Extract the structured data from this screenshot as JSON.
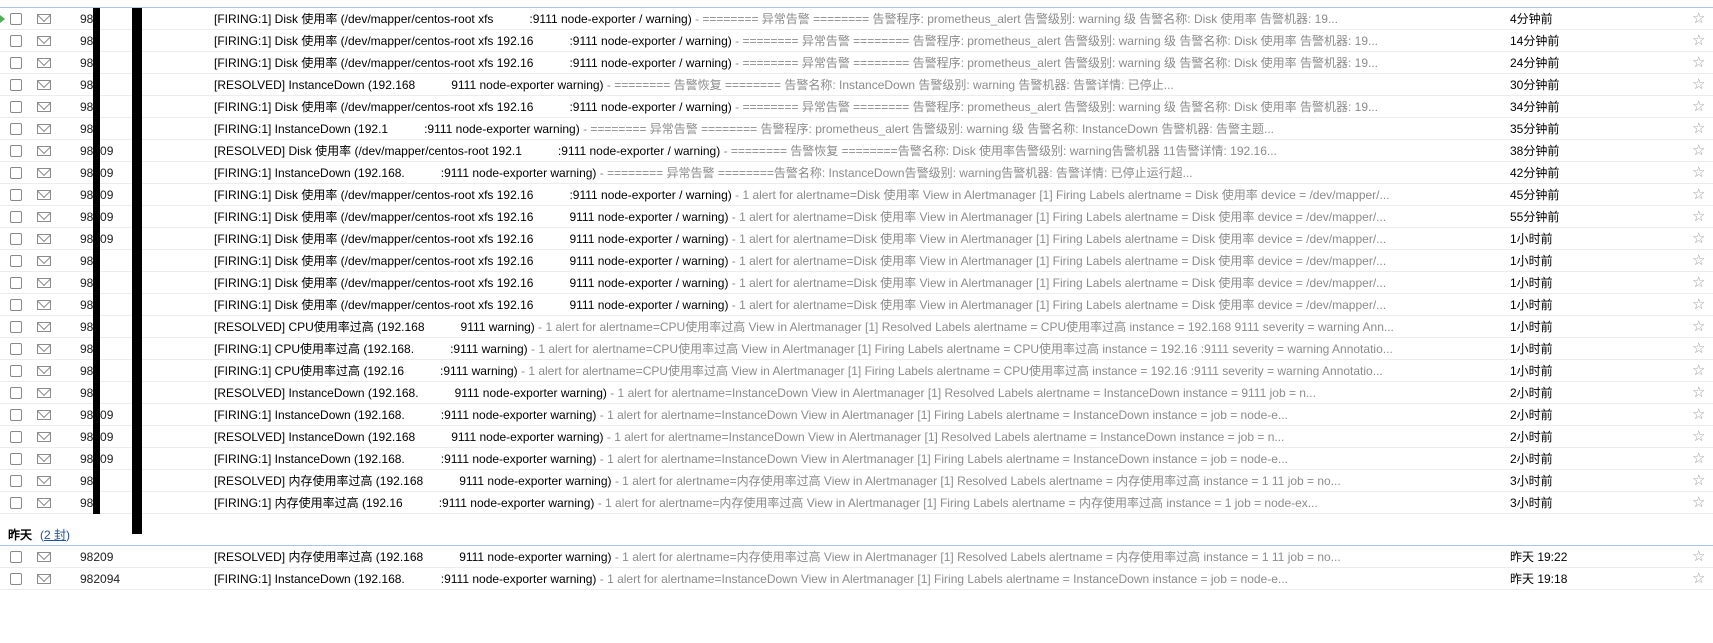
{
  "prev_group": {
    "label": "",
    "count_link": ""
  },
  "rows_today": [
    {
      "sender": "98",
      "title": "[FIRING:1] Disk 使用率 (/dev/mapper/centos-root xfs",
      "title_tail": ":9111 node-exporter / warning)",
      "summary": " - ======== 异常告警 ======== 告警程序: prometheus_alert 告警级别: warning 级 告警名称: Disk 使用率 告警机器: 19...",
      "time": "4分钟前",
      "current": true
    },
    {
      "sender": "98",
      "title": "[FIRING:1] Disk 使用率 (/dev/mapper/centos-root xfs 192.16",
      "title_tail": ":9111 node-exporter / warning)",
      "summary": " - ======== 异常告警 ======== 告警程序: prometheus_alert 告警级别: warning 级 告警名称: Disk 使用率 告警机器: 19...",
      "time": "14分钟前",
      "current": false
    },
    {
      "sender": "98",
      "title": "[FIRING:1] Disk 使用率 (/dev/mapper/centos-root xfs 192.16",
      "title_tail": ":9111 node-exporter / warning)",
      "summary": " - ======== 异常告警 ======== 告警程序: prometheus_alert 告警级别: warning 级 告警名称: Disk 使用率 告警机器: 19...",
      "time": "24分钟前",
      "current": false
    },
    {
      "sender": "98",
      "title": "[RESOLVED] InstanceDown (192.168",
      "title_tail": "9111 node-exporter warning)",
      "summary": " - ======== 告警恢复 ======== 告警名称: InstanceDown 告警级别: warning 告警机器: 告警详情: 已停止...",
      "time": "30分钟前",
      "current": false
    },
    {
      "sender": "98",
      "title": "[FIRING:1] Disk 使用率 (/dev/mapper/centos-root xfs 192.16",
      "title_tail": ":9111 node-exporter / warning)",
      "summary": " - ======== 异常告警 ======== 告警程序: prometheus_alert 告警级别: warning 级 告警名称: Disk 使用率 告警机器: 19...",
      "time": "34分钟前",
      "current": false
    },
    {
      "sender": "98",
      "title": "[FIRING:1] InstanceDown (192.1",
      "title_tail": ":9111 node-exporter warning)",
      "summary": " - ======== 异常告警 ======== 告警程序: prometheus_alert 告警级别: warning 级 告警名称: InstanceDown 告警机器: 告警主题...",
      "time": "35分钟前",
      "current": false
    },
    {
      "sender": "98209",
      "title": "[RESOLVED] Disk 使用率 (/dev/mapper/centos-root 192.1",
      "title_tail": ":9111 node-exporter / warning)",
      "summary": " - ======== 告警恢复 ========告警名称: Disk 使用率告警级别: warning告警机器 11告警详情: 192.16...",
      "time": "38分钟前",
      "current": false
    },
    {
      "sender": "98209",
      "title": "[FIRING:1] InstanceDown (192.168.",
      "title_tail": ":9111 node-exporter warning)",
      "summary": " - ======== 异常告警 ========告警名称: InstanceDown告警级别: warning告警机器: 告警详情: 已停止运行超...",
      "time": "42分钟前",
      "current": false
    },
    {
      "sender": "98209",
      "title": "[FIRING:1] Disk 使用率 (/dev/mapper/centos-root xfs 192.16",
      "title_tail": ":9111 node-exporter / warning)",
      "summary": " - 1 alert for alertname=Disk 使用率 View in Alertmanager [1] Firing Labels alertname = Disk 使用率 device = /dev/mapper/...",
      "time": "45分钟前",
      "current": false
    },
    {
      "sender": "98209",
      "title": "[FIRING:1] Disk 使用率 (/dev/mapper/centos-root xfs 192.16",
      "title_tail": "9111 node-exporter / warning)",
      "summary": " - 1 alert for alertname=Disk 使用率 View in Alertmanager [1] Firing Labels alertname = Disk 使用率 device = /dev/mapper/...",
      "time": "55分钟前",
      "current": false
    },
    {
      "sender": "98209",
      "title": "[FIRING:1] Disk 使用率 (/dev/mapper/centos-root xfs 192.16",
      "title_tail": "9111 node-exporter / warning)",
      "summary": " - 1 alert for alertname=Disk 使用率 View in Alertmanager [1] Firing Labels alertname = Disk 使用率 device = /dev/mapper/...",
      "time": "1小时前",
      "current": false
    },
    {
      "sender": "98",
      "title": "[FIRING:1] Disk 使用率 (/dev/mapper/centos-root xfs 192.16",
      "title_tail": "9111 node-exporter / warning)",
      "summary": " - 1 alert for alertname=Disk 使用率 View in Alertmanager [1] Firing Labels alertname = Disk 使用率 device = /dev/mapper/...",
      "time": "1小时前",
      "current": false
    },
    {
      "sender": "98",
      "title": "[FIRING:1] Disk 使用率 (/dev/mapper/centos-root xfs 192.16",
      "title_tail": "9111 node-exporter / warning)",
      "summary": " - 1 alert for alertname=Disk 使用率 View in Alertmanager [1] Firing Labels alertname = Disk 使用率 device = /dev/mapper/...",
      "time": "1小时前",
      "current": false
    },
    {
      "sender": "98",
      "title": "[FIRING:1] Disk 使用率 (/dev/mapper/centos-root xfs 192.16",
      "title_tail": "9111 node-exporter / warning)",
      "summary": " - 1 alert for alertname=Disk 使用率 View in Alertmanager [1] Firing Labels alertname = Disk 使用率 device = /dev/mapper/...",
      "time": "1小时前",
      "current": false
    },
    {
      "sender": "98",
      "title": "[RESOLVED] CPU使用率过高 (192.168",
      "title_tail": "9111 warning)",
      "summary": " - 1 alert for alertname=CPU使用率过高 View in Alertmanager [1] Resolved Labels alertname = CPU使用率过高 instance = 192.168 9111 severity = warning Ann...",
      "time": "1小时前",
      "current": false
    },
    {
      "sender": "98",
      "title": "[FIRING:1] CPU使用率过高 (192.168.",
      "title_tail": ":9111 warning)",
      "summary": " - 1 alert for alertname=CPU使用率过高 View in Alertmanager [1] Firing Labels alertname = CPU使用率过高 instance = 192.16 :9111 severity = warning Annotatio...",
      "time": "1小时前",
      "current": false
    },
    {
      "sender": "98",
      "title": "[FIRING:1] CPU使用率过高 (192.16",
      "title_tail": ":9111 warning)",
      "summary": " - 1 alert for alertname=CPU使用率过高 View in Alertmanager [1] Firing Labels alertname = CPU使用率过高 instance = 192.16 :9111 severity = warning Annotatio...",
      "time": "1小时前",
      "current": false
    },
    {
      "sender": "98",
      "title": "[RESOLVED] InstanceDown (192.168.",
      "title_tail": "9111 node-exporter warning)",
      "summary": " - 1 alert for alertname=InstanceDown View in Alertmanager [1] Resolved Labels alertname = InstanceDown instance = 9111 job = n...",
      "time": "2小时前",
      "current": false
    },
    {
      "sender": "98209",
      "title": "[FIRING:1] InstanceDown (192.168.",
      "title_tail": ":9111 node-exporter warning)",
      "summary": " - 1 alert for alertname=InstanceDown View in Alertmanager [1] Firing Labels alertname = InstanceDown instance = job = node-e...",
      "time": "2小时前",
      "current": false
    },
    {
      "sender": "98209",
      "title": "[RESOLVED] InstanceDown (192.168",
      "title_tail": "9111 node-exporter warning)",
      "summary": " - 1 alert for alertname=InstanceDown View in Alertmanager [1] Resolved Labels alertname = InstanceDown instance = job = n...",
      "time": "2小时前",
      "current": false
    },
    {
      "sender": "98209",
      "title": "[FIRING:1] InstanceDown (192.168.",
      "title_tail": ":9111 node-exporter warning)",
      "summary": " - 1 alert for alertname=InstanceDown View in Alertmanager [1] Firing Labels alertname = InstanceDown instance = job = node-e...",
      "time": "2小时前",
      "current": false
    },
    {
      "sender": "98",
      "title": "[RESOLVED] 内存使用率过高 (192.168",
      "title_tail": "9111 node-exporter warning)",
      "summary": " - 1 alert for alertname=内存使用率过高 View in Alertmanager [1] Resolved Labels alertname = 内存使用率过高 instance = 1 11 job = no...",
      "time": "3小时前",
      "current": false
    },
    {
      "sender": "98",
      "title": "[FIRING:1] 内存使用率过高 (192.16",
      "title_tail": ":9111 node-exporter warning)",
      "summary": " - 1 alert for alertname=内存使用率过高 View in Alertmanager [1] Firing Labels alertname = 内存使用率过高 instance = 1 job = node-ex...",
      "time": "3小时前",
      "current": false
    }
  ],
  "group_yesterday": {
    "label": "昨天",
    "count_prefix": "(",
    "count_link": "2 封",
    "count_suffix": ")"
  },
  "rows_yesterday": [
    {
      "sender": "98209",
      "title": "[RESOLVED] 内存使用率过高 (192.168",
      "title_tail": "9111 node-exporter warning)",
      "summary": " - 1 alert for alertname=内存使用率过高 View in Alertmanager [1] Resolved Labels alertname = 内存使用率过高 instance = 1 11 job = no...",
      "time": "昨天 19:22",
      "current": false
    },
    {
      "sender": "982094",
      "title": "[FIRING:1] InstanceDown (192.168.",
      "title_tail": ":9111 node-exporter warning)",
      "summary": " - 1 alert for alertname=InstanceDown View in Alertmanager [1] Firing Labels alertname = InstanceDown instance = job = node-e...",
      "time": "昨天 19:18",
      "current": false
    }
  ],
  "icons": {
    "checkbox": "checkbox-icon",
    "read_mail": "envelope-open-icon",
    "star": "star-icon",
    "current": "current-row-arrow-icon"
  },
  "colors": {
    "group_line": "#a9c6e8",
    "link": "#1e5494",
    "summary_text": "#8c8c8c",
    "star": "#9c9c9c",
    "current_marker": "#4caf50"
  },
  "glyphs": {
    "star": "☆"
  }
}
